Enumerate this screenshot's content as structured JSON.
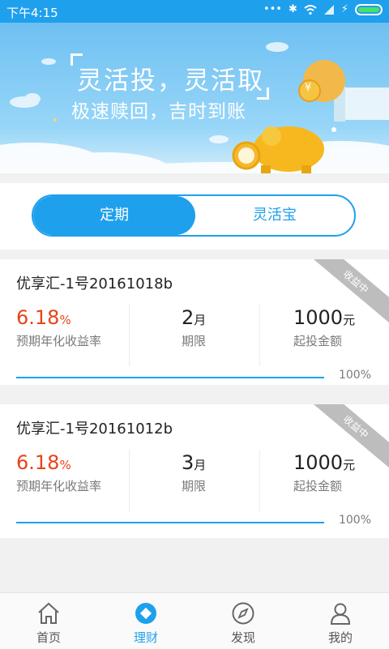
{
  "status_bar": {
    "time": "下午4:15"
  },
  "banner": {
    "line1": "灵活投，灵活取",
    "line2": "极速赎回，吉时到账",
    "coin_symbol": "¥"
  },
  "segment": {
    "tabs": [
      "定期",
      "灵活宝"
    ],
    "active_index": 0
  },
  "products": [
    {
      "name": "优享汇-1号20161018b",
      "badge": "收益中",
      "rate": "6.18",
      "rate_unit": "%",
      "rate_label": "预期年化收益率",
      "term": "2",
      "term_unit": "月",
      "term_label": "期限",
      "min": "1000",
      "min_unit": "元",
      "min_label": "起投金额",
      "progress": "100%"
    },
    {
      "name": "优享汇-1号20161012b",
      "badge": "收益中",
      "rate": "6.18",
      "rate_unit": "%",
      "rate_label": "预期年化收益率",
      "term": "3",
      "term_unit": "月",
      "term_label": "期限",
      "min": "1000",
      "min_unit": "元",
      "min_label": "起投金额",
      "progress": "100%"
    }
  ],
  "bottom_nav": [
    {
      "label": "首页",
      "icon": "home-icon"
    },
    {
      "label": "理财",
      "icon": "finance-icon"
    },
    {
      "label": "发现",
      "icon": "compass-icon"
    },
    {
      "label": "我的",
      "icon": "user-icon"
    }
  ],
  "colors": {
    "accent": "#1ea0ec",
    "rate": "#e84318"
  }
}
